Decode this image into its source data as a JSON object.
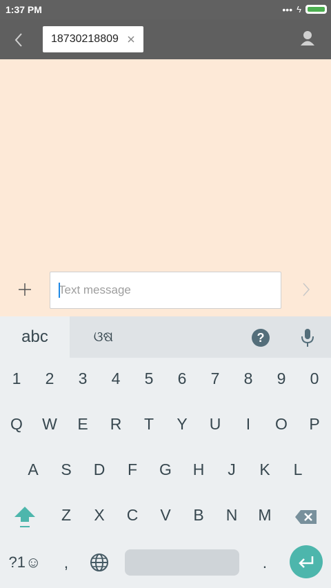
{
  "status_bar": {
    "time": "1:37 PM",
    "signal": "•••",
    "charging": "ϟ"
  },
  "header": {
    "recipient": "18730218809",
    "chip_close": "×"
  },
  "composer": {
    "placeholder": "Text message"
  },
  "keyboard": {
    "lang_primary": "abc",
    "lang_secondary": "ଓଷ",
    "help": "?",
    "numbers": [
      "1",
      "2",
      "3",
      "4",
      "5",
      "6",
      "7",
      "8",
      "9",
      "0"
    ],
    "row_qwerty": [
      "Q",
      "W",
      "E",
      "R",
      "T",
      "Y",
      "U",
      "I",
      "O",
      "P"
    ],
    "row_asdf": [
      "A",
      "S",
      "D",
      "F",
      "G",
      "H",
      "J",
      "K",
      "L"
    ],
    "row_zxcv": [
      "Z",
      "X",
      "C",
      "V",
      "B",
      "N",
      "M"
    ],
    "symbols_label": "?1☺",
    "comma": ",",
    "period": "."
  },
  "colors": {
    "header_bg": "#5f5f5f",
    "conversation_bg": "#fde9d7",
    "accent_teal": "#4db6ac",
    "keyboard_bg": "#eceff1"
  }
}
